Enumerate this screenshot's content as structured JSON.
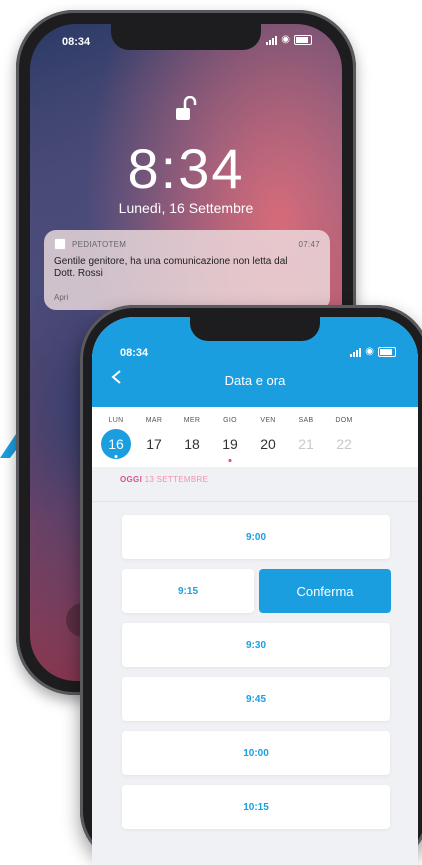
{
  "lock_screen": {
    "status_time": "08:34",
    "time": "8:34",
    "date": "Lunedì, 16 Settembre",
    "notification": {
      "app": "PEDIATOTEM",
      "time": "07:47",
      "message": "Gentile genitore, ha una comunicazione non letta dal Dott. Rossi",
      "action": "Apri"
    }
  },
  "app": {
    "status_time": "08:34",
    "header_title": "Data e ora",
    "accent_color": "#1b9ee0",
    "week": [
      {
        "dow": "LUN",
        "day": "16",
        "state": "selected"
      },
      {
        "dow": "MAR",
        "day": "17",
        "state": "normal"
      },
      {
        "dow": "MER",
        "day": "18",
        "state": "normal"
      },
      {
        "dow": "GIO",
        "day": "19",
        "state": "marked"
      },
      {
        "dow": "VEN",
        "day": "20",
        "state": "normal"
      },
      {
        "dow": "SAB",
        "day": "21",
        "state": "disabled"
      },
      {
        "dow": "DOM",
        "day": "22",
        "state": "disabled"
      }
    ],
    "today_prefix": "OGGI",
    "today_date": "13 SETTEMBRE",
    "slots": [
      "9:00",
      "9:15",
      "9:30",
      "9:45",
      "10:00",
      "10:15"
    ],
    "confirm_label": "Conferma"
  }
}
